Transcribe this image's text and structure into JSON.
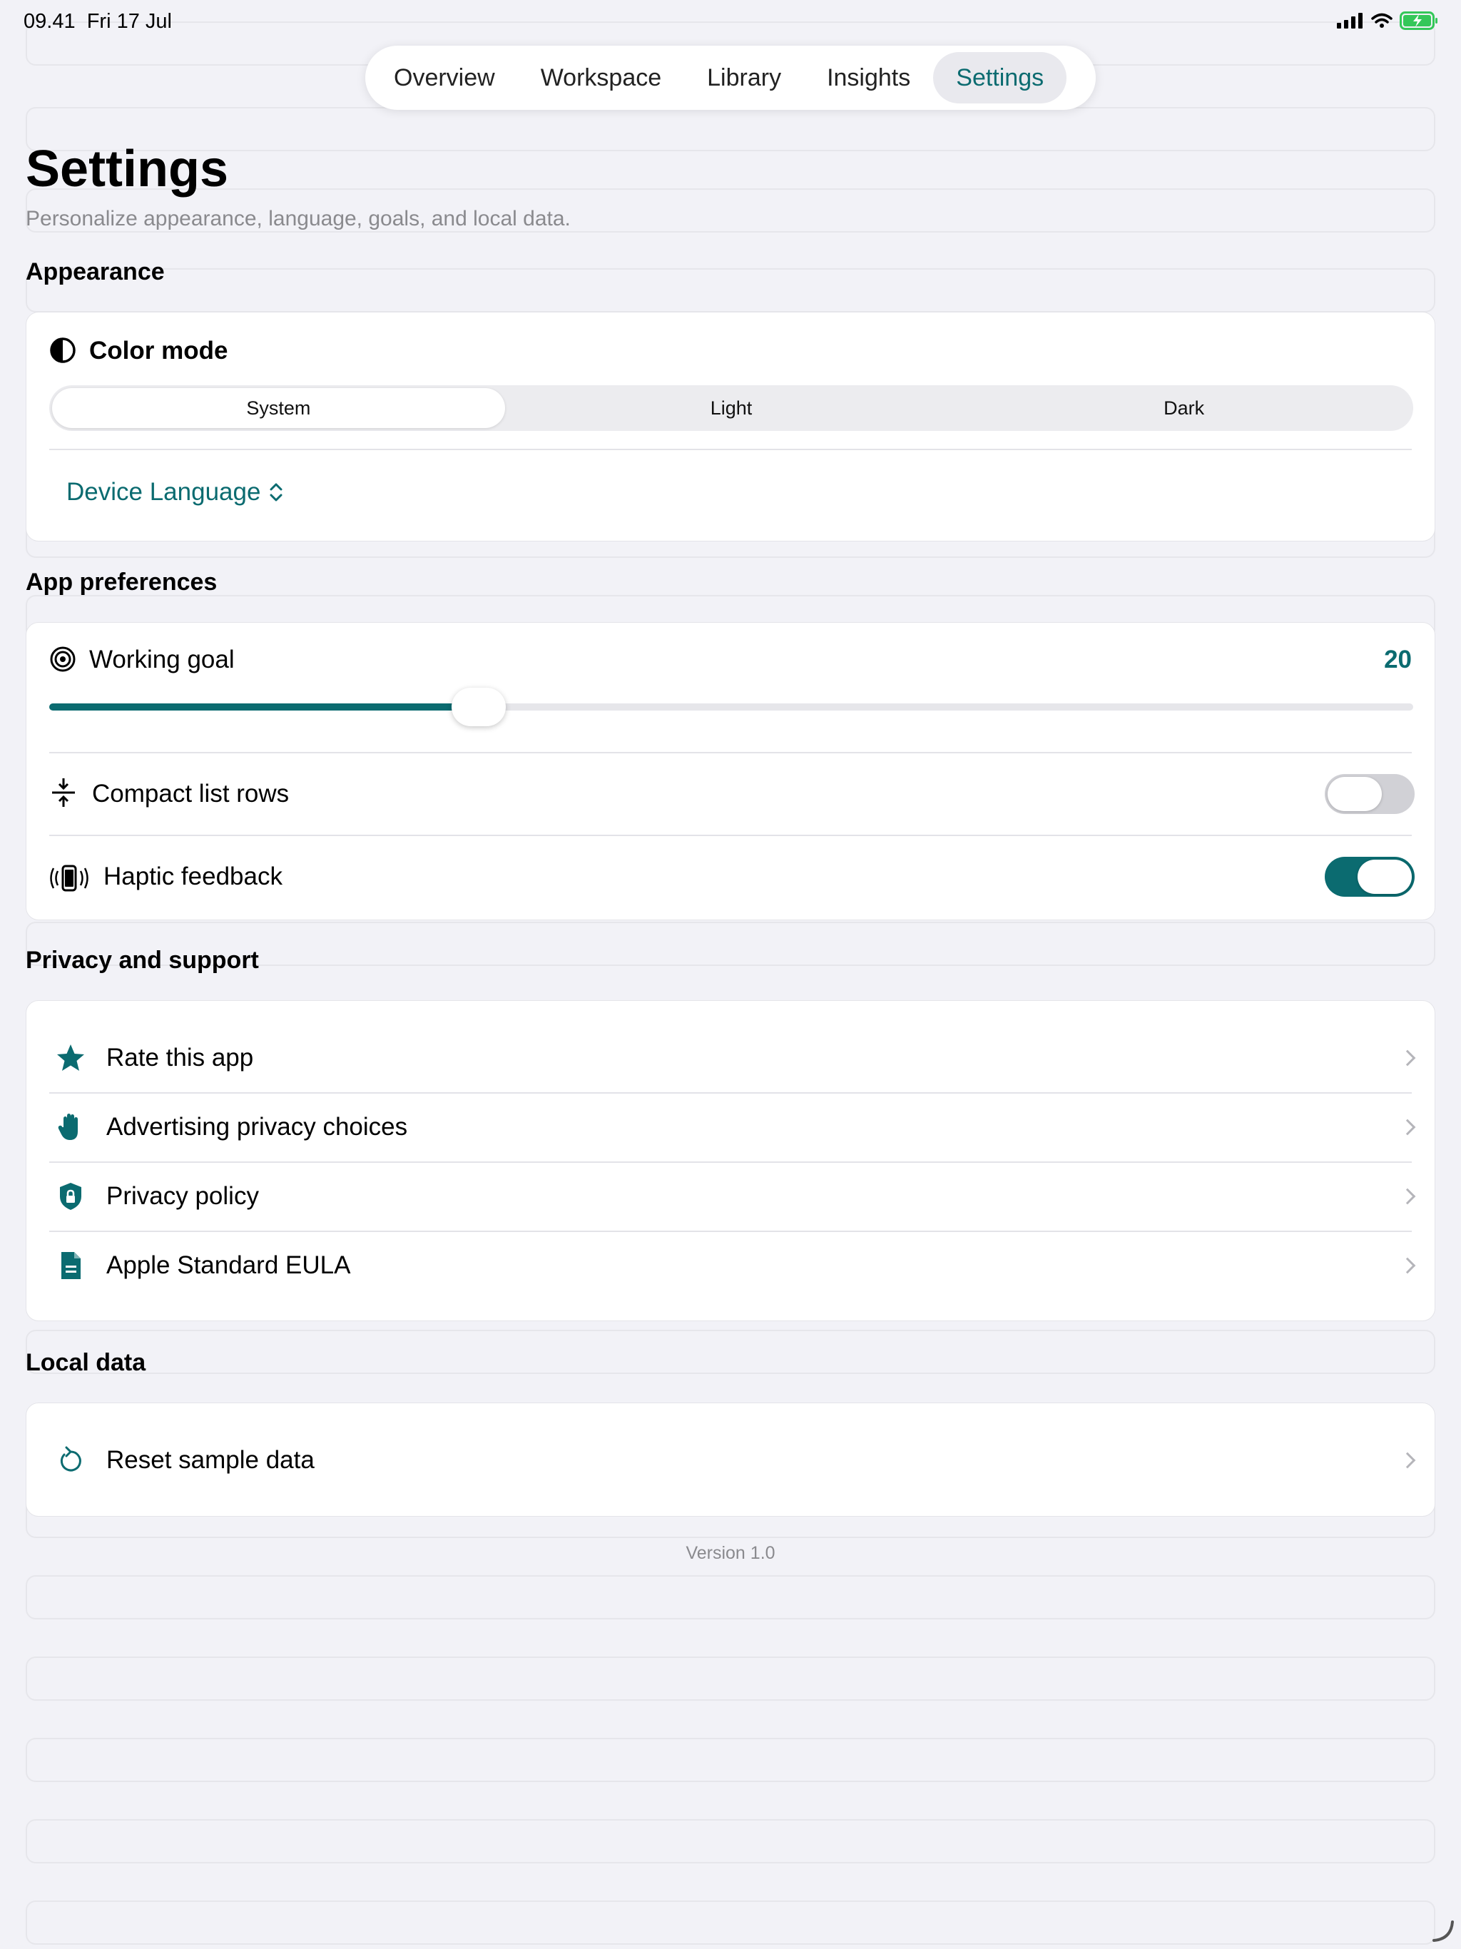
{
  "status": {
    "time": "09.41",
    "date": "Fri 17 Jul"
  },
  "tabs": [
    {
      "label": "Overview"
    },
    {
      "label": "Workspace"
    },
    {
      "label": "Library"
    },
    {
      "label": "Insights"
    },
    {
      "label": "Settings",
      "active": true
    }
  ],
  "page": {
    "title": "Settings",
    "subtitle": "Personalize appearance, language, goals, and local data."
  },
  "appearance": {
    "heading": "Appearance",
    "color_mode_label": "Color mode",
    "segments": [
      "System",
      "Light",
      "Dark"
    ],
    "selected_segment": "System",
    "language_label": "Device Language"
  },
  "preferences": {
    "heading": "App preferences",
    "working_goal_label": "Working goal",
    "working_goal_value": "20",
    "working_goal_fraction": 0.315,
    "compact_label": "Compact list rows",
    "compact_on": false,
    "haptic_label": "Haptic feedback",
    "haptic_on": true
  },
  "privacy": {
    "heading": "Privacy and support",
    "items": [
      {
        "label": "Rate this app",
        "icon": "star-icon"
      },
      {
        "label": "Advertising privacy choices",
        "icon": "hand-icon"
      },
      {
        "label": "Privacy policy",
        "icon": "shield-lock-icon"
      },
      {
        "label": "Apple Standard EULA",
        "icon": "document-icon"
      }
    ]
  },
  "local_data": {
    "heading": "Local data",
    "reset_label": "Reset sample data"
  },
  "version": "Version 1.0",
  "colors": {
    "accent": "#0b6b70",
    "background": "#f2f2f7"
  }
}
